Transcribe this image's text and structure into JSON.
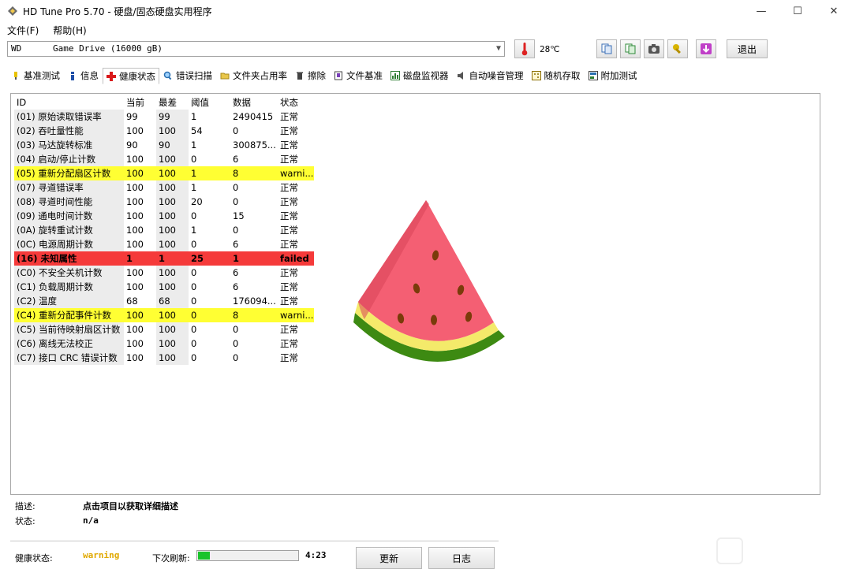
{
  "window": {
    "title": "HD Tune Pro 5.70 - 硬盘/固态硬盘实用程序",
    "minimize": "—",
    "maximize": "☐",
    "close": "✕"
  },
  "menu": [
    "文件(F)",
    "帮助(H)"
  ],
  "drive": {
    "selected": "WD      Game Drive (16000 gB)",
    "temperature": "28℃",
    "exit_label": "退出"
  },
  "tabs": [
    {
      "label": "基准测试",
      "icon": "benchmark-icon",
      "active": false
    },
    {
      "label": "信息",
      "icon": "info-icon",
      "active": false
    },
    {
      "label": "健康状态",
      "icon": "health-cross-icon",
      "active": true
    },
    {
      "label": "错误扫描",
      "icon": "magnifier-icon",
      "active": false
    },
    {
      "label": "文件夹占用率",
      "icon": "folder-icon",
      "active": false
    },
    {
      "label": "擦除",
      "icon": "trash-icon",
      "active": false
    },
    {
      "label": "文件基准",
      "icon": "file-benchmark-icon",
      "active": false
    },
    {
      "label": "磁盘监视器",
      "icon": "monitor-chart-icon",
      "active": false
    },
    {
      "label": "自动噪音管理",
      "icon": "speaker-icon",
      "active": false
    },
    {
      "label": "随机存取",
      "icon": "random-access-icon",
      "active": false
    },
    {
      "label": "附加测试",
      "icon": "extra-test-icon",
      "active": false
    }
  ],
  "smart": {
    "headers": [
      "ID",
      "当前",
      "最差",
      "阈值",
      "数据",
      "状态"
    ],
    "rows": [
      {
        "id": "(01) 原始读取错误率",
        "cur": "99",
        "worst": "99",
        "th": "1",
        "data": "2490415",
        "status": "正常",
        "level": "ok"
      },
      {
        "id": "(02) 吞吐量性能",
        "cur": "100",
        "worst": "100",
        "th": "54",
        "data": "0",
        "status": "正常",
        "level": "ok"
      },
      {
        "id": "(03) 马达旋转标准",
        "cur": "90",
        "worst": "90",
        "th": "1",
        "data": "300875...",
        "status": "正常",
        "level": "ok"
      },
      {
        "id": "(04) 启动/停止计数",
        "cur": "100",
        "worst": "100",
        "th": "0",
        "data": "6",
        "status": "正常",
        "level": "ok"
      },
      {
        "id": "(05) 重新分配扇区计数",
        "cur": "100",
        "worst": "100",
        "th": "1",
        "data": "8",
        "status": "warni...",
        "level": "warning"
      },
      {
        "id": "(07) 寻道错误率",
        "cur": "100",
        "worst": "100",
        "th": "1",
        "data": "0",
        "status": "正常",
        "level": "ok"
      },
      {
        "id": "(08) 寻道时间性能",
        "cur": "100",
        "worst": "100",
        "th": "20",
        "data": "0",
        "status": "正常",
        "level": "ok"
      },
      {
        "id": "(09) 通电时间计数",
        "cur": "100",
        "worst": "100",
        "th": "0",
        "data": "15",
        "status": "正常",
        "level": "ok"
      },
      {
        "id": "(0A) 旋转重试计数",
        "cur": "100",
        "worst": "100",
        "th": "1",
        "data": "0",
        "status": "正常",
        "level": "ok"
      },
      {
        "id": "(0C) 电源周期计数",
        "cur": "100",
        "worst": "100",
        "th": "0",
        "data": "6",
        "status": "正常",
        "level": "ok"
      },
      {
        "id": "(16) 未知属性",
        "cur": "1",
        "worst": "1",
        "th": "25",
        "data": "1",
        "status": "failed",
        "level": "failed"
      },
      {
        "id": "(C0) 不安全关机计数",
        "cur": "100",
        "worst": "100",
        "th": "0",
        "data": "6",
        "status": "正常",
        "level": "ok"
      },
      {
        "id": "(C1) 负载周期计数",
        "cur": "100",
        "worst": "100",
        "th": "0",
        "data": "6",
        "status": "正常",
        "level": "ok"
      },
      {
        "id": "(C2) 温度",
        "cur": "68",
        "worst": "68",
        "th": "0",
        "data": "176094...",
        "status": "正常",
        "level": "ok"
      },
      {
        "id": "(C4) 重新分配事件计数",
        "cur": "100",
        "worst": "100",
        "th": "0",
        "data": "8",
        "status": "warni...",
        "level": "warning"
      },
      {
        "id": "(C5) 当前待映射扇区计数",
        "cur": "100",
        "worst": "100",
        "th": "0",
        "data": "0",
        "status": "正常",
        "level": "ok"
      },
      {
        "id": "(C6) 离线无法校正",
        "cur": "100",
        "worst": "100",
        "th": "0",
        "data": "0",
        "status": "正常",
        "level": "ok"
      },
      {
        "id": "(C7) 接口 CRC 错误计数",
        "cur": "100",
        "worst": "100",
        "th": "0",
        "data": "0",
        "status": "正常",
        "level": "ok"
      }
    ]
  },
  "description": {
    "desc_label": "描述:",
    "desc_value": "点击项目以获取详细描述",
    "status_label": "状态:",
    "status_value": "n/a"
  },
  "bottom": {
    "health_label": "健康状态:",
    "health_value": "warning",
    "refresh_label": "下次刷新:",
    "refresh_progress": 0.12,
    "countdown": "4:23",
    "update_label": "更新",
    "log_label": "日志"
  },
  "colors": {
    "warning_row": "#ffff33",
    "failed_row": "#f53a3a",
    "progress_fill": "#19c32a"
  }
}
